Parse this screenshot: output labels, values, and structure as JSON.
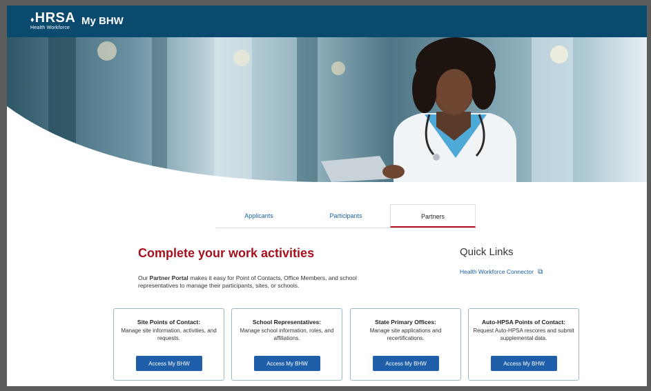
{
  "header": {
    "logo_text": "HRSA",
    "logo_subtext": "Health Workforce",
    "app_title": "My BHW"
  },
  "tabs": [
    {
      "label": "Applicants",
      "active": false
    },
    {
      "label": "Participants",
      "active": false
    },
    {
      "label": "Partners",
      "active": true
    }
  ],
  "main": {
    "headline": "Complete your work activities",
    "intro_prefix": "Our ",
    "intro_bold": "Partner Portal",
    "intro_suffix": " makes it easy for Point of Contacts, Office Members, and school representatives to manage their participants, sites, or schools."
  },
  "quick_links": {
    "title": "Quick Links",
    "items": [
      {
        "label": "Health Workforce Connector",
        "icon": "external-link-icon"
      }
    ]
  },
  "cards": [
    {
      "title": "Site Points of Contact:",
      "description": "Manage site information, activities, and requests.",
      "button_label": "Access My BHW"
    },
    {
      "title": "School Representatives:",
      "description": "Manage school information, roles, and affiliations.",
      "button_label": "Access My BHW"
    },
    {
      "title": "State Primary Offices:",
      "description": "Manage site applications and recertifications.",
      "button_label": "Access My BHW"
    },
    {
      "title": "Auto-HPSA Points of Contact:",
      "description": "Request Auto-HPSA rescores and submit supplemental data.",
      "button_label": "Access My BHW"
    }
  ],
  "colors": {
    "header_bg": "#0b4a6f",
    "accent_red": "#a6101e",
    "button_blue": "#1f5ea8",
    "link_blue": "#1a5fa8"
  }
}
